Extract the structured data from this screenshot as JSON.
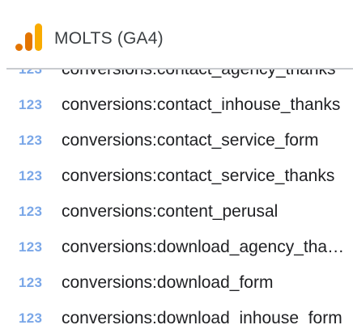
{
  "header": {
    "title": "MOLTS (GA4)",
    "logo": "google-analytics-icon",
    "colors": {
      "bar_dark": "#e37400",
      "bar_light": "#f9ab00"
    }
  },
  "field_icon": {
    "text": "123",
    "icon": "numeric-field-icon",
    "color": "#7aa7e8"
  },
  "fields": [
    {
      "label": "conversions:contact_agency_thanks"
    },
    {
      "label": "conversions:contact_inhouse_thanks"
    },
    {
      "label": "conversions:contact_service_form"
    },
    {
      "label": "conversions:contact_service_thanks"
    },
    {
      "label": "conversions:content_perusal"
    },
    {
      "label": "conversions:download_agency_thanks"
    },
    {
      "label": "conversions:download_form"
    },
    {
      "label": "conversions:download_inhouse_form"
    }
  ]
}
